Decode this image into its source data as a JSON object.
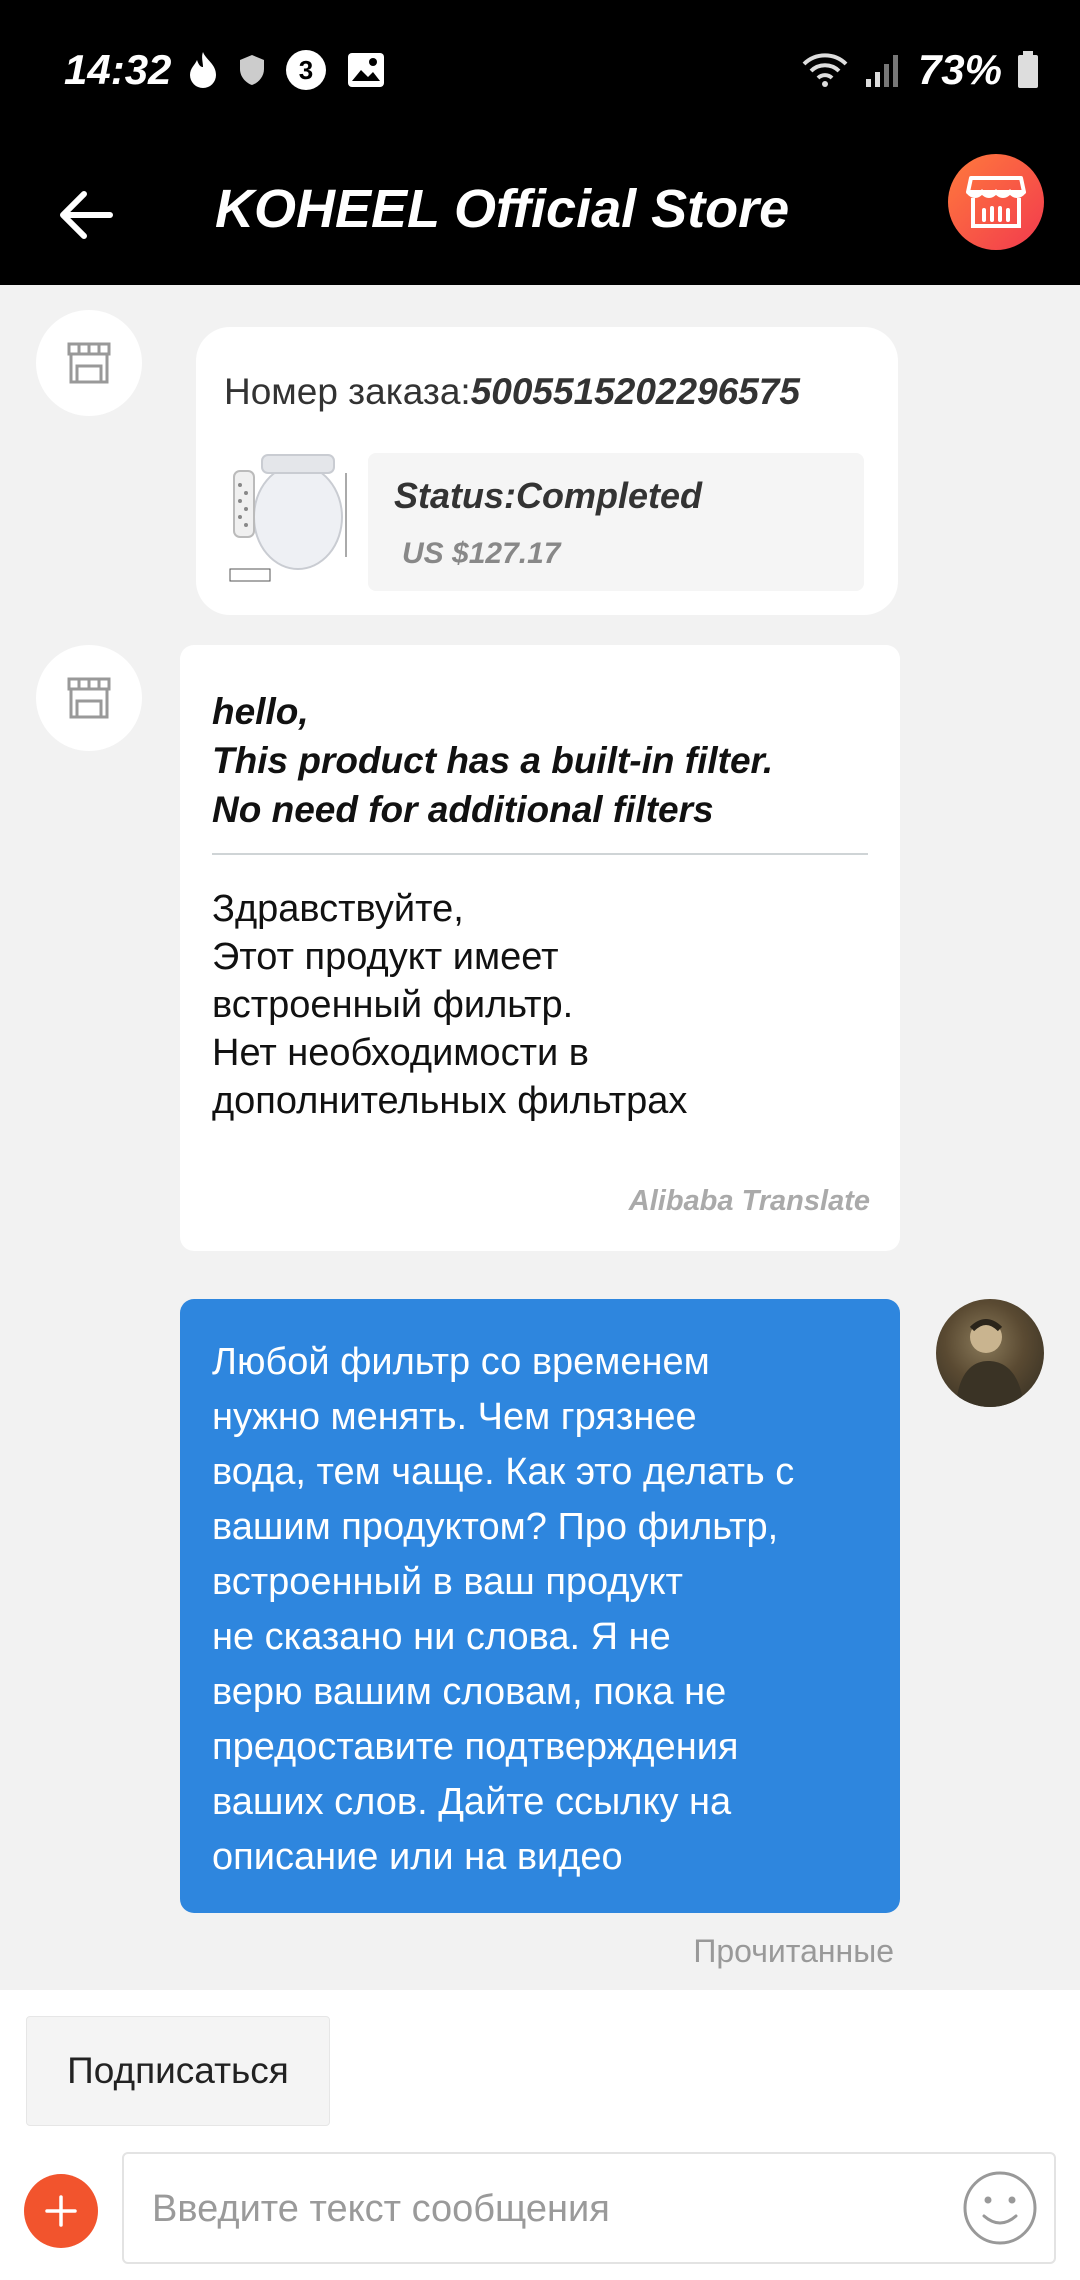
{
  "status_bar": {
    "time": "14:32",
    "notification_count": "3",
    "battery": "73%"
  },
  "header": {
    "title": "KOHEEL Official Store",
    "accent": "#f23a4e"
  },
  "order_card": {
    "order_label": "Номер заказа:",
    "order_number": "5005515202296575",
    "status": "Status:Completed",
    "price": "US $127.17"
  },
  "seller_message": {
    "english_lines": [
      "hello,",
      "This product has a built-in filter.",
      "No need for additional filters"
    ],
    "russian_lines": [
      "Здравствуйте,",
      "Этот продукт имеет",
      "встроенный фильтр.",
      "Нет необходимости в",
      "дополнительных фильтрах"
    ],
    "translator": "Alibaba Translate"
  },
  "my_message": {
    "lines": [
      "Любой фильтр со временем",
      "нужно менять. Чем грязнее",
      "вода, тем чаще. Как это делать с",
      "вашим продуктом? Про фильтр,",
      "встроенный в ваш продукт",
      "не сказано ни слова. Я не",
      "верю вашим словам, пока не",
      "предоставите подтверждения",
      "ваших слов. Дайте ссылку на",
      "описание или на видео"
    ],
    "bubble_color": "#2e86de",
    "read_status": "Прочитанные"
  },
  "bottom_bar": {
    "subscribe_label": "Подписаться",
    "input_placeholder": "Введите текст сообщения",
    "plus_color": "#f2542d"
  }
}
